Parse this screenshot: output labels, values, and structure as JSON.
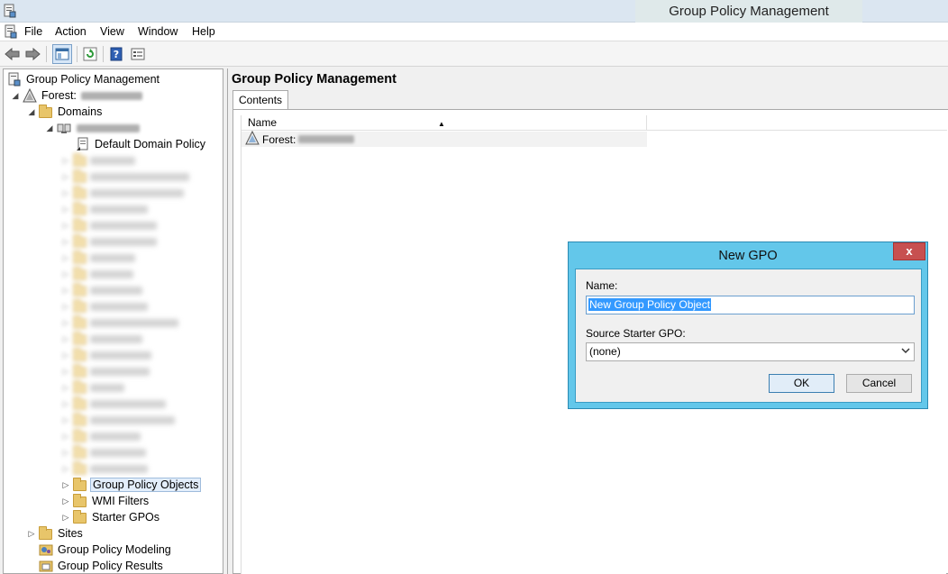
{
  "window": {
    "title": "Group Policy Management"
  },
  "menu": [
    "File",
    "Action",
    "View",
    "Window",
    "Help"
  ],
  "tree": {
    "root": "Group Policy Management",
    "forest_label": "Forest:",
    "domains": "Domains",
    "default_policy": "Default Domain Policy",
    "gpo_objects": "Group Policy Objects",
    "wmi_filters": "WMI Filters",
    "starter_gpos": "Starter GPOs",
    "sites": "Sites",
    "modeling": "Group Policy Modeling",
    "results": "Group Policy Results"
  },
  "main": {
    "title": "Group Policy Management",
    "tab": "Contents",
    "column_name": "Name",
    "row_forest_label": "Forest:"
  },
  "dialog": {
    "title": "New GPO",
    "close": "x",
    "name_label": "Name:",
    "name_value": "New Group Policy Object",
    "source_label": "Source Starter GPO:",
    "source_value": "(none)",
    "ok": "OK",
    "cancel": "Cancel"
  },
  "colors": {
    "dialog_frame": "#63c7ea",
    "selection": "#3399ff",
    "close_button": "#c75050"
  }
}
